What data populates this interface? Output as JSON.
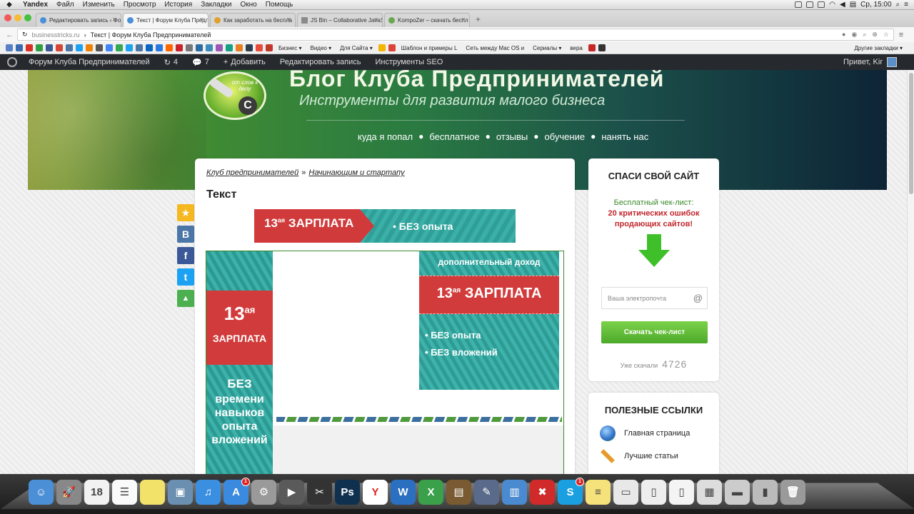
{
  "menubar": {
    "items": [
      "Yandex",
      "Файл",
      "Изменить",
      "Просмотр",
      "История",
      "Закладки",
      "Окно",
      "Помощь"
    ],
    "clock": "Ср, 15:00"
  },
  "tabs": [
    {
      "label": "Редактировать запись ‹ Фо",
      "active": false
    },
    {
      "label": "Текст | Форум Клуба Предп",
      "active": true
    },
    {
      "label": "Как заработать на беспла",
      "active": false
    },
    {
      "label": "JS Bin – Collaborative JavaSc",
      "active": false
    },
    {
      "label": "KompoZer – скачать беспл",
      "active": false
    }
  ],
  "address": {
    "domain": "businesstricks.ru",
    "separator": "›",
    "title": "Текст | Форум Клуба Предпринимателей"
  },
  "bookmarks": {
    "folders": [
      "Бизнес ▾",
      "Видео ▾",
      "Для Сайта ▾",
      "Шаблон и примеры L",
      "Сеть между Mac OS и",
      "Сериалы ▾",
      "вера"
    ],
    "other": "Другие закладки ▾"
  },
  "wpbar": {
    "site": "Форум Клуба Предпринимателей",
    "updates": "4",
    "comments": "7",
    "add": "Добавить",
    "edit": "Редактировать запись",
    "seo": "Инструменты SEO",
    "greeting": "Привет, Kir"
  },
  "header": {
    "logo_text": "от слов к делу",
    "logo_letter": "C",
    "title": "Блог Клуба Предпринимателей",
    "subtitle": "Инструменты для развития малого бизнеса",
    "nav": [
      "куда я попал",
      "бесплатное",
      "отзывы",
      "обучение",
      "нанять нас"
    ]
  },
  "content": {
    "breadcrumb": [
      "Клуб предпринимателей",
      "Начинающим и стартапу"
    ],
    "breadcrumb_sep": "»",
    "title": "Текст",
    "banner_top": {
      "num": "13",
      "sup": "ая",
      "word": "ЗАРПЛАТА",
      "text": "• БЕЗ опыта"
    },
    "banner_vertical": {
      "num": "13",
      "sup": "ая",
      "word": "ЗАРПЛАТА",
      "bez": "БЕЗ",
      "list": [
        "времени",
        "навыков",
        "опыта",
        "вложений"
      ]
    },
    "banner_square": {
      "top": "дополнительный доход",
      "num": "13",
      "sup": "ая",
      "word": "ЗАРПЛАТА",
      "l1": "• БЕЗ опыта",
      "l2": "• БЕЗ вложений"
    }
  },
  "share": [
    "★",
    "B",
    "f",
    "t",
    "▲"
  ],
  "sidebar": {
    "box1": {
      "title": "СПАСИ СВОЙ САЙТ",
      "green": "Бесплатный чек-лист:",
      "red1": "20 критических ошибок",
      "red2": "продающих сайтов!",
      "email_placeholder": "Ваша электропочта",
      "button": "Скачать чек-лист",
      "downloaded_label": "Уже скачали",
      "downloaded_count": "4726"
    },
    "box2": {
      "title": "ПОЛЕЗНЫЕ ССЫЛКИ",
      "links": [
        "Главная страница",
        "Лучшие статьи"
      ]
    }
  },
  "dock": [
    {
      "name": "finder-icon",
      "color": "#4b8fd6",
      "glyph": "☺"
    },
    {
      "name": "launchpad-icon",
      "color": "#888888",
      "glyph": "🚀"
    },
    {
      "name": "calendar-icon",
      "color": "#f2f2f2",
      "glyph": "18"
    },
    {
      "name": "reminders-icon",
      "color": "#fafafa",
      "glyph": "☰"
    },
    {
      "name": "stickies-icon",
      "color": "#f3e26a",
      "glyph": ""
    },
    {
      "name": "iphoto-icon",
      "color": "#6a8fb0",
      "glyph": "▣"
    },
    {
      "name": "itunes-icon",
      "color": "#3b8fe0",
      "glyph": "♫"
    },
    {
      "name": "appstore-icon",
      "color": "#3a8ae0",
      "glyph": "A",
      "badge": "1"
    },
    {
      "name": "preferences-icon",
      "color": "#9a9a9a",
      "glyph": "⚙"
    },
    {
      "name": "imovie-icon",
      "color": "#5a5a5a",
      "glyph": "▶"
    },
    {
      "name": "finalcut-icon",
      "color": "#333333",
      "glyph": "✂"
    },
    {
      "name": "photoshop-icon",
      "color": "#10304f",
      "glyph": "Ps"
    },
    {
      "name": "yandex-icon",
      "color": "#ffffff",
      "glyph": "Y"
    },
    {
      "name": "word-icon",
      "color": "#2a6fc0",
      "glyph": "W"
    },
    {
      "name": "excel-icon",
      "color": "#3aa04a",
      "glyph": "X"
    },
    {
      "name": "keynote-icon",
      "color": "#7a5a30",
      "glyph": "▤"
    },
    {
      "name": "quill-icon",
      "color": "#5a6a8a",
      "glyph": "✎"
    },
    {
      "name": "numbers-icon",
      "color": "#4a8ad0",
      "glyph": "▥"
    },
    {
      "name": "crossover-icon",
      "color": "#d02a2a",
      "glyph": "✖"
    },
    {
      "name": "skype-icon",
      "color": "#1aa0e0",
      "glyph": "S",
      "badge": "1"
    },
    {
      "name": "notes-icon",
      "color": "#f5e27a",
      "glyph": "≡"
    },
    {
      "name": "printer-icon",
      "color": "#e8e8e8",
      "glyph": "▭"
    },
    {
      "name": "doc-icon",
      "color": "#eeeeee",
      "glyph": "▯"
    },
    {
      "name": "file-icon",
      "color": "#f4f4f4",
      "glyph": "▯"
    },
    {
      "name": "preview-icon",
      "color": "#dddddd",
      "glyph": "▦"
    },
    {
      "name": "scanner-icon",
      "color": "#cccccc",
      "glyph": "▬"
    },
    {
      "name": "device-icon",
      "color": "#bbbbbb",
      "glyph": "▮"
    },
    {
      "name": "trash-icon",
      "color": "#9a9a9a",
      "glyph": "🗑"
    }
  ]
}
